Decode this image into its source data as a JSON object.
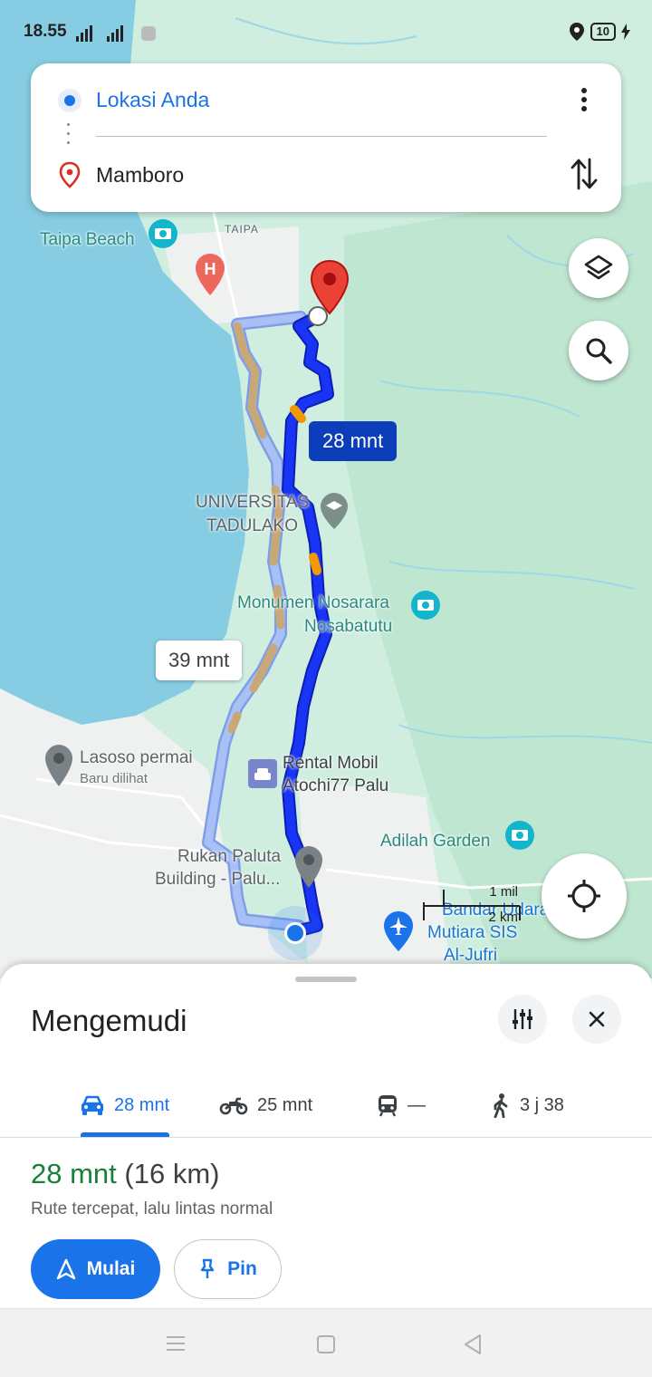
{
  "status_bar": {
    "time": "18.55",
    "network": "4G",
    "battery": "10"
  },
  "search": {
    "origin": "Lokasi Anda",
    "destination": "Mamboro"
  },
  "map": {
    "labels": {
      "taipa_beach": "Taipa Beach",
      "taipa": "TAIPA",
      "universitas": "UNIVERSITAS",
      "tadulako": "TADULAKO",
      "monumen_1": "Monumen Nosarara",
      "monumen_2": "Nosabatutu",
      "lasoso": "Lasoso permai",
      "lasoso_sub": "Baru dilihat",
      "rental_1": "Rental Mobil",
      "rental_2": "Atochi77 Palu",
      "adilah": "Adilah Garden",
      "rukan_1": "Rukan Paluta",
      "rukan_2": "Building - Palu...",
      "bandara_1": "Bandar Udara",
      "bandara_2": "Mutiara SIS",
      "bandara_3": "Al-Jufri"
    },
    "route_main_label": "28 mnt",
    "route_alt_label": "39 mnt",
    "scale_top": "1 mil",
    "scale_bottom": "2 km",
    "colors": {
      "route_main": "#1a34f5",
      "route_alt": "#98b4f4",
      "traffic": "#f29900",
      "water": "#86cde3",
      "land": "#cfeee0"
    }
  },
  "sheet": {
    "title": "Mengemudi",
    "tabs": [
      {
        "icon": "car-icon",
        "label": "28 mnt"
      },
      {
        "icon": "motorcycle-icon",
        "label": "25 mnt"
      },
      {
        "icon": "transit-icon",
        "label": "—"
      },
      {
        "icon": "walk-icon",
        "label": "3 j 38"
      }
    ],
    "route_time": "28 mnt",
    "route_distance": "(16 km)",
    "route_desc": "Rute tercepat, lalu lintas normal",
    "start_label": "Mulai",
    "pin_label": "Pin"
  }
}
